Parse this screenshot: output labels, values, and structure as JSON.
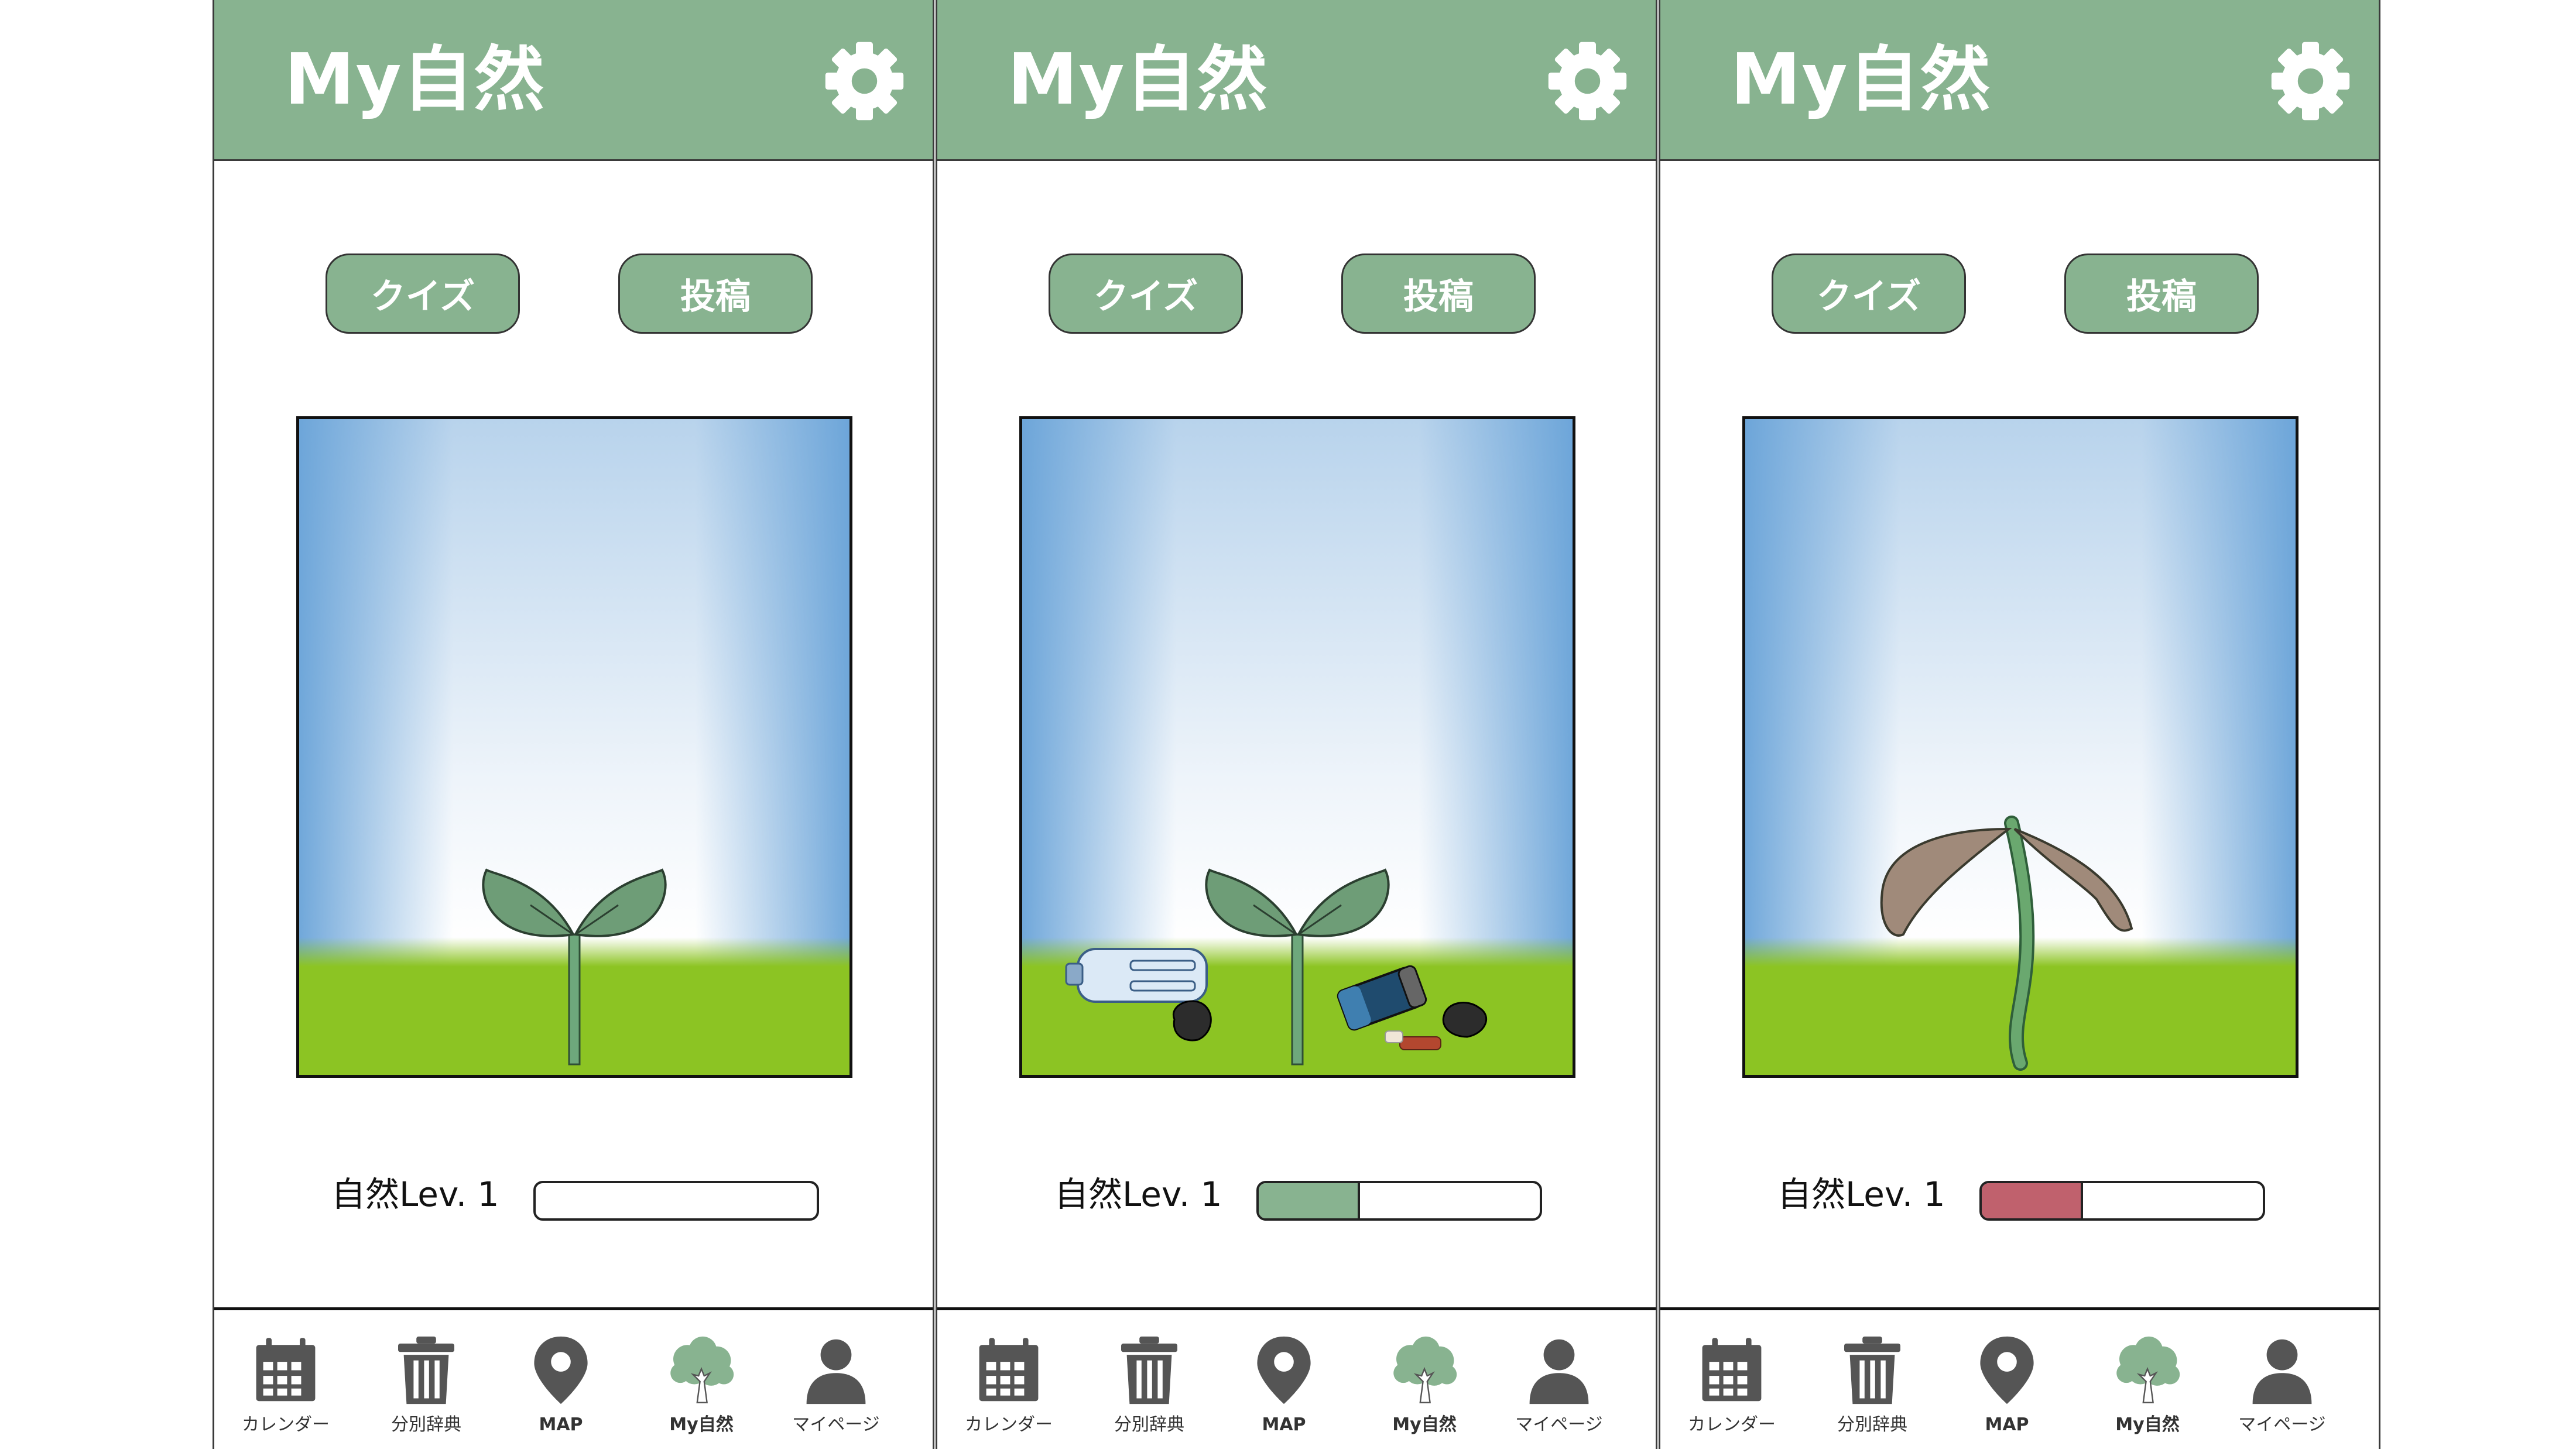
{
  "colors": {
    "header": "#88b390",
    "button": "#88b390",
    "sky_edge": "#69a3d8",
    "grass": "#8cc423",
    "level_good": "#88b390",
    "level_bad": "#c0616d",
    "tab_icon": "#555555",
    "tab_icon_active": "#88b390"
  },
  "screens": [
    {
      "header": {
        "title": "My自然",
        "settings_icon": "gear-icon"
      },
      "buttons": {
        "quiz": "クイズ",
        "post": "投稿"
      },
      "scene": {
        "state": "healthy-sprout",
        "litter": false
      },
      "level": {
        "label": "自然Lev. 1",
        "progress": 0,
        "bar_color": "#ffffff"
      }
    },
    {
      "header": {
        "title": "My自然",
        "settings_icon": "gear-icon"
      },
      "buttons": {
        "quiz": "クイズ",
        "post": "投稿"
      },
      "scene": {
        "state": "healthy-sprout",
        "litter": true
      },
      "level": {
        "label": "自然Lev. 1",
        "progress": 0.36,
        "bar_color": "#88b390"
      }
    },
    {
      "header": {
        "title": "My自然",
        "settings_icon": "gear-icon"
      },
      "buttons": {
        "quiz": "クイズ",
        "post": "投稿"
      },
      "scene": {
        "state": "wilted-sprout",
        "litter": false
      },
      "level": {
        "label": "自然Lev. 1",
        "progress": 0.36,
        "bar_color": "#c0616d"
      }
    }
  ],
  "tabbar": [
    {
      "label": "カレンダー",
      "icon": "calendar-icon",
      "active": false
    },
    {
      "label": "分別辞典",
      "icon": "trash-can-icon",
      "active": false
    },
    {
      "label": "MAP",
      "icon": "map-pin-icon",
      "active": false
    },
    {
      "label": "My自然",
      "icon": "tree-icon",
      "active": true
    },
    {
      "label": "マイページ",
      "icon": "person-icon",
      "active": false
    }
  ]
}
